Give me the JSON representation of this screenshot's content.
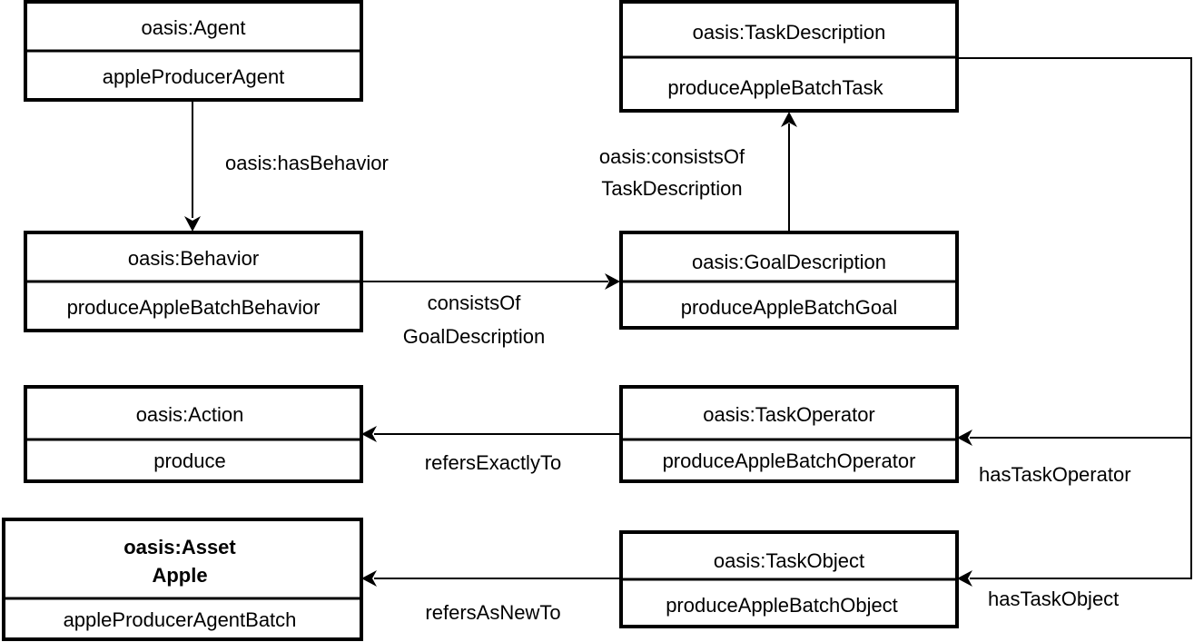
{
  "nodes": {
    "agent": {
      "type": "oasis:Agent",
      "instance": "appleProducerAgent"
    },
    "task_description": {
      "type": "oasis:TaskDescription",
      "instance": "produceAppleBatchTask"
    },
    "behavior": {
      "type": "oasis:Behavior",
      "instance": "produceAppleBatchBehavior"
    },
    "goal_description": {
      "type": "oasis:GoalDescription",
      "instance": "produceAppleBatchGoal"
    },
    "action": {
      "type": "oasis:Action",
      "instance": "produce"
    },
    "task_operator": {
      "type": "oasis:TaskOperator",
      "instance": "produceAppleBatchOperator"
    },
    "asset": {
      "type": "oasis:Asset",
      "type_line2": "Apple",
      "instance": "appleProducerAgentBatch"
    },
    "task_object": {
      "type": "oasis:TaskObject",
      "instance": "produceAppleBatchObject"
    }
  },
  "edges": {
    "has_behavior": "oasis:hasBehavior",
    "consists_of_goal": {
      "line1": "consistsOf",
      "line2": "GoalDescription"
    },
    "consists_of_task": {
      "line1": "oasis:consistsOf",
      "line2": "TaskDescription"
    },
    "has_task_operator": "hasTaskOperator",
    "has_task_object": "hasTaskObject",
    "refers_exactly_to": "refersExactlyTo",
    "refers_as_new_to": "refersAsNewTo"
  }
}
